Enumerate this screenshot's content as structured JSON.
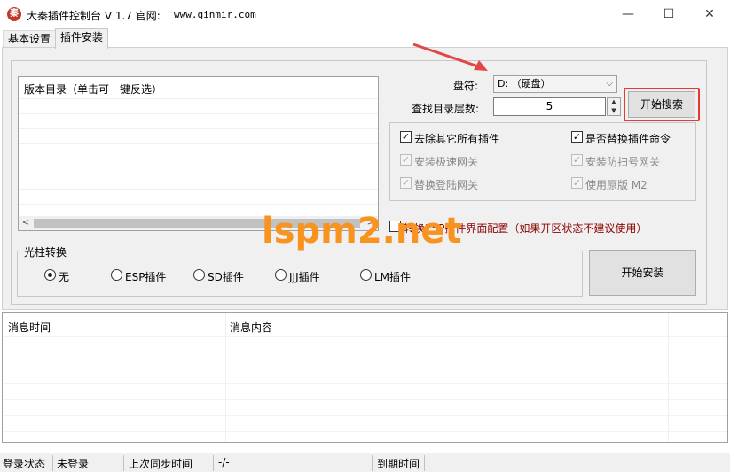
{
  "window": {
    "icon_glyph": "秦",
    "title": "大秦插件控制台 V 1.7  官网:",
    "site": "www.qinmir.com",
    "minimize_glyph": "—",
    "maximize_glyph": "☐",
    "close_glyph": "✕"
  },
  "tabs": [
    {
      "label": "基本设置"
    },
    {
      "label": "插件安装"
    }
  ],
  "version_list": {
    "header": "版本目录（单击可一键反选）",
    "left_arrow": "<",
    "right_arrow": ">"
  },
  "drive": {
    "label": "盘符:",
    "value": "D: （硬盘）",
    "arrow": "⌵"
  },
  "depth": {
    "label": "查找目录层数:",
    "value": "5"
  },
  "search_button": "开始搜索",
  "options": [
    {
      "label": "去除其它所有插件",
      "checked": true,
      "enabled": true
    },
    {
      "label": "是否替换插件命令",
      "checked": true,
      "enabled": true
    },
    {
      "label": "安装极速网关",
      "checked": true,
      "enabled": false
    },
    {
      "label": "安装防扫号网关",
      "checked": true,
      "enabled": false
    },
    {
      "label": "替换登陆网关",
      "checked": true,
      "enabled": false
    },
    {
      "label": "使用原版 M2",
      "checked": true,
      "enabled": false
    }
  ],
  "check_mark": "✓",
  "esp_option": {
    "label": "转换ESP插件界面配置（如果开区状态不建议使用）",
    "checked": false
  },
  "cursor_group": {
    "title": "光柱转换",
    "options": [
      {
        "label": "无",
        "selected": true
      },
      {
        "label": "ESP插件",
        "selected": false
      },
      {
        "label": "SD插件",
        "selected": false
      },
      {
        "label": "JJJ插件",
        "selected": false
      },
      {
        "label": "LM插件",
        "selected": false
      }
    ]
  },
  "install_button": "开始安装",
  "watermark": "lspm2.net",
  "log": {
    "columns": [
      "消息时间",
      "消息内容"
    ]
  },
  "status": {
    "login_label": "登录状态",
    "login_value": "未登录",
    "sync_label": "上次同步时间",
    "sync_value": "-/-",
    "expire_label": "到期时间",
    "expire_value": ""
  },
  "colors": {
    "highlight": "#e53935",
    "arrow": "#e04848",
    "watermark": "#f7931e",
    "warning_text": "#8b0000"
  }
}
